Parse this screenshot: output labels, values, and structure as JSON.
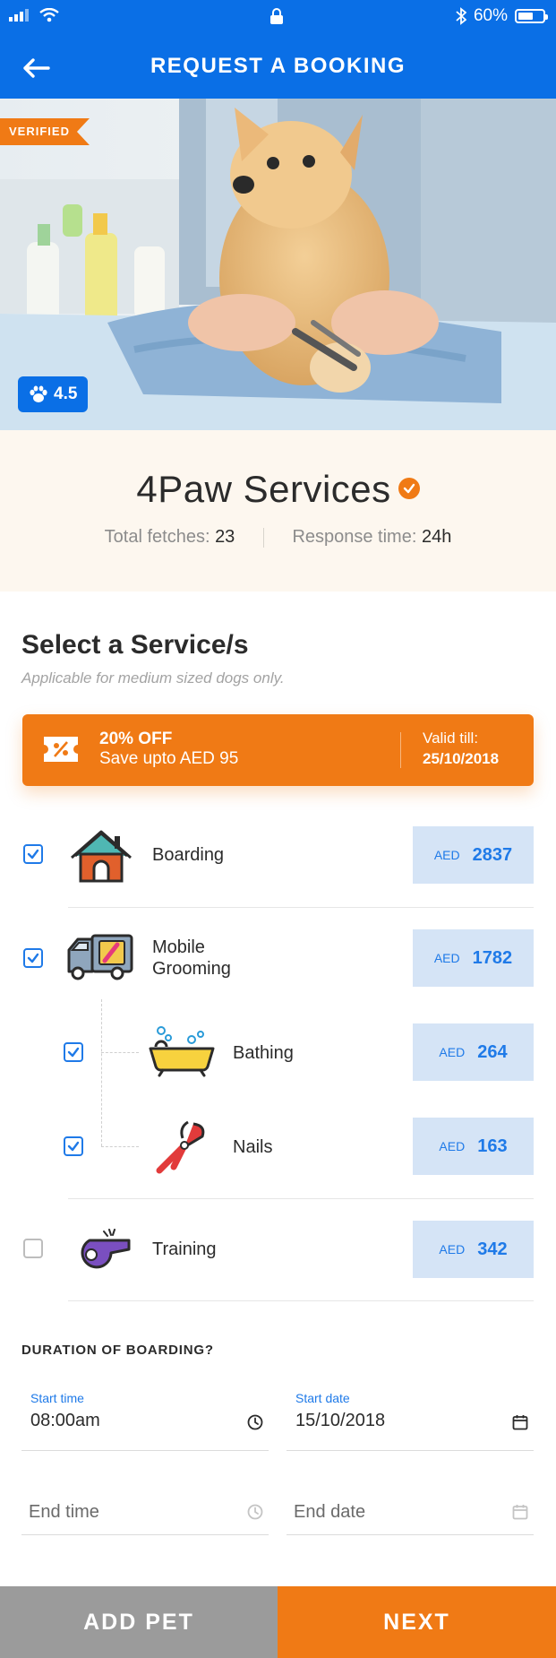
{
  "status_bar": {
    "battery": "60%",
    "battery_level": 0.6
  },
  "header": {
    "title": "REQUEST A BOOKING"
  },
  "hero": {
    "badge": "VERIFIED",
    "rating": "4.5"
  },
  "provider": {
    "name": "4Paw Services",
    "total_fetches_label": "Total fetches:",
    "total_fetches": "23",
    "response_time_label": "Response time:",
    "response_time": "24h"
  },
  "services_section": {
    "title": "Select a Service/s",
    "subtitle": "Applicable for medium sized dogs only."
  },
  "offer": {
    "title": "20% OFF",
    "subtitle": "Save upto AED 95",
    "valid_label": "Valid till:",
    "valid_date": "25/10/2018"
  },
  "services": [
    {
      "label": "Boarding",
      "currency": "AED",
      "price": "2837",
      "checked": true
    },
    {
      "label": "Mobile Grooming",
      "label_line1": "Mobile",
      "label_line2": "Grooming",
      "currency": "AED",
      "price": "1782",
      "checked": true
    },
    {
      "label": "Bathing",
      "currency": "AED",
      "price": "264",
      "checked": true
    },
    {
      "label": "Nails",
      "currency": "AED",
      "price": "163",
      "checked": true
    },
    {
      "label": "Training",
      "currency": "AED",
      "price": "342",
      "checked": false
    }
  ],
  "duration": {
    "title": "DURATION OF BOARDING?",
    "start_time_label": "Start time",
    "start_time_value": "08:00am",
    "start_date_label": "Start date",
    "start_date_value": "15/10/2018",
    "end_time_placeholder": "End time",
    "end_date_placeholder": "End date"
  },
  "actions": {
    "add_pet": "ADD PET",
    "next": "NEXT"
  },
  "colors": {
    "primary_blue": "#0a6fe6",
    "accent_orange": "#f07a15",
    "price_bg": "#d5e4f6",
    "provider_bg": "#fdf7ef",
    "button_grey": "#9b9b9b"
  },
  "icons": {
    "signal": "signal-icon",
    "wifi": "wifi-icon",
    "lock": "lock-icon",
    "bluetooth": "bluetooth-icon",
    "back": "arrow-left-icon",
    "rating": "paw-icon",
    "verified": "check-badge-icon",
    "offer": "coupon-icon",
    "boarding": "house-icon",
    "grooming": "grooming-van-icon",
    "bathing": "bathtub-icon",
    "nails": "nail-clipper-icon",
    "training": "whistle-icon",
    "time": "clock-icon",
    "date": "calendar-icon"
  }
}
